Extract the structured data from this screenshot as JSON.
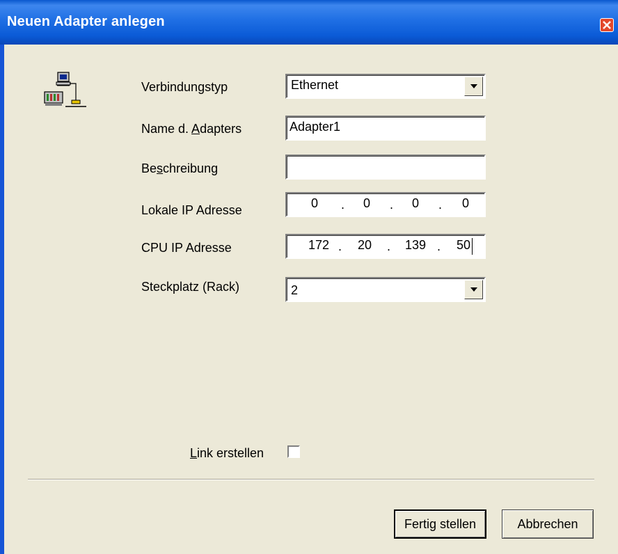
{
  "window": {
    "title": "Neuen Adapter anlegen"
  },
  "icons": {
    "adapter": "network-adapter-icon",
    "close": "close-icon",
    "dropdown": "chevron-down-icon"
  },
  "form": {
    "connection_type": {
      "label": "Verbindungstyp",
      "value": "Ethernet"
    },
    "adapter_name": {
      "label_pre": "Name d. ",
      "label_key": "A",
      "label_post": "dapters",
      "value": "Adapter1"
    },
    "description": {
      "label_pre": "Be",
      "label_key": "s",
      "label_post": "chreibung",
      "value": ""
    },
    "local_ip": {
      "label": "Lokale IP Adresse",
      "octets": [
        "0",
        "0",
        "0",
        "0"
      ],
      "dot": "."
    },
    "cpu_ip": {
      "label": "CPU IP Adresse",
      "octets": [
        "172",
        "20",
        "139",
        "50"
      ],
      "dot": "."
    },
    "slot": {
      "label": "Steckplatz (Rack)",
      "value": "2"
    },
    "link": {
      "label_key": "L",
      "label_post": "ink erstellen",
      "checked": false
    }
  },
  "buttons": {
    "finish": "Fertig stellen",
    "cancel": "Abbrechen"
  },
  "colors": {
    "titlebar": "#0b5bd7",
    "face": "#ece9d8",
    "close": "#e3472a"
  }
}
